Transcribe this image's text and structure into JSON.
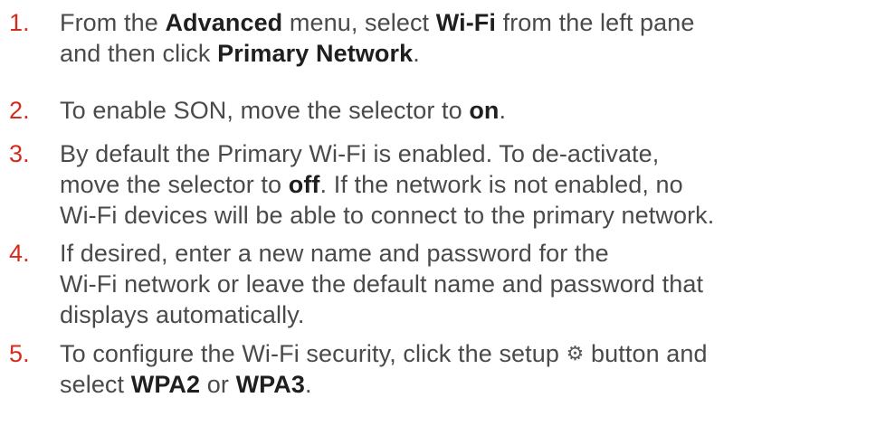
{
  "steps": [
    {
      "number": "1.",
      "parts": [
        "From the ",
        "Advanced",
        " menu, select ",
        "Wi-Fi",
        " from the left pane",
        "and then click ",
        "Primary Network",
        "."
      ]
    },
    {
      "number": "2.",
      "parts": [
        "To enable SON, move the selector to ",
        "on",
        "."
      ]
    },
    {
      "number": "3.",
      "parts": [
        "By default the Primary Wi-Fi is enabled. To de-activate,",
        "move the selector to ",
        "off",
        ". If the network is not enabled, no",
        "Wi-Fi devices will be able to connect to the primary network."
      ]
    },
    {
      "number": "4.",
      "parts": [
        "If desired, enter a new name and password for the",
        "Wi-Fi network or leave the default name and password that",
        "displays automatically."
      ]
    },
    {
      "number": "5.",
      "parts": [
        "To configure the Wi-Fi security, click the setup ",
        " button and",
        "select ",
        "WPA2",
        " or ",
        "WPA3",
        "."
      ]
    }
  ],
  "icons": {
    "setup": "gear-icon"
  },
  "colors": {
    "number": "#d52b1e",
    "text": "#4a4a4a",
    "bold": "#1f1f1f"
  }
}
